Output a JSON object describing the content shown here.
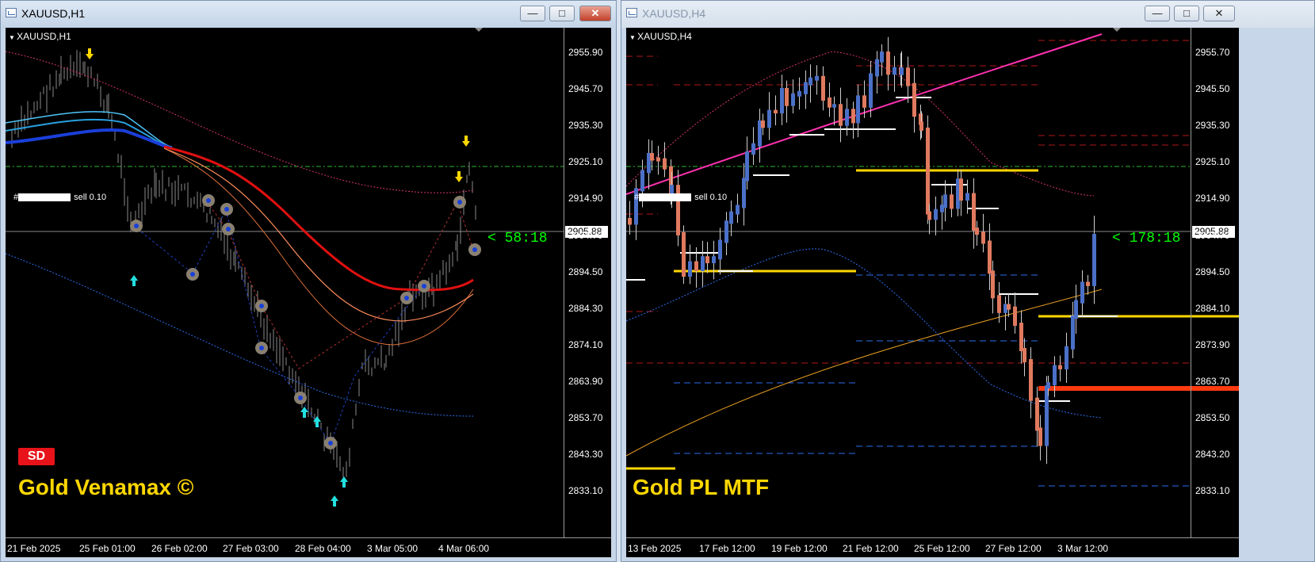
{
  "windows": [
    {
      "title": "XAUUSD,H1",
      "chart_symbol": "XAUUSD,H1",
      "price_ticks": [
        "2955.90",
        "2945.70",
        "2935.30",
        "2925.10",
        "2914.90",
        "2904.70",
        "2894.50",
        "2884.30",
        "2874.10",
        "2863.90",
        "2853.70",
        "2843.30",
        "2833.10"
      ],
      "time_labels": [
        "21 Feb 2025",
        "25 Feb 01:00",
        "26 Feb 02:00",
        "27 Feb 03:00",
        "28 Feb 04:00",
        "3 Mar 05:00",
        "4 Mar 06:00"
      ],
      "current_price": "2905.88",
      "timer": "< 58:18",
      "trade_label": "sell 0.10",
      "trade_hash": "#",
      "badge": "SD",
      "brand": "Gold Venamax ©"
    },
    {
      "title": "XAUUSD,H4",
      "chart_symbol": "XAUUSD,H4",
      "price_ticks": [
        "2955.70",
        "2945.50",
        "2935.30",
        "2925.10",
        "2914.90",
        "2904.70",
        "2894.50",
        "2884.10",
        "2873.90",
        "2863.70",
        "2853.50",
        "2843.20",
        "2833.10"
      ],
      "time_labels": [
        "13 Feb 2025",
        "17 Feb 12:00",
        "19 Feb 12:00",
        "21 Feb 12:00",
        "25 Feb 12:00",
        "27 Feb 12:00",
        "3 Mar 12:00"
      ],
      "current_price": "2905.88",
      "timer": "< 178:18",
      "trade_label": "sell 0.10",
      "trade_hash": "#",
      "brand": "Gold PL MTF"
    }
  ],
  "window_buttons": {
    "minimize": "—",
    "maximize": "□",
    "close": "✕"
  },
  "colors": {
    "chart_bg": "#000000",
    "bull": "#4b70c8",
    "bear": "#e07a5f",
    "brand": "#ffd700",
    "timer": "#00ff00",
    "badge": "#e8131a"
  }
}
